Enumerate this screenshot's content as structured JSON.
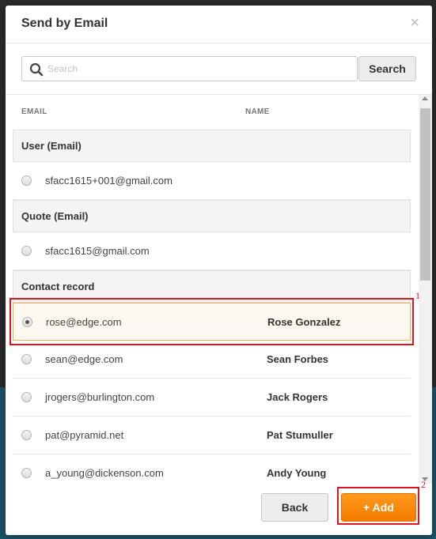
{
  "dialog": {
    "title": "Send by Email",
    "close_glyph": "×"
  },
  "search": {
    "placeholder": "Search",
    "value": "",
    "button_label": "Search"
  },
  "columns": {
    "email": "EMAIL",
    "name": "NAME"
  },
  "groups": [
    {
      "label": "User (Email)",
      "rows": [
        {
          "email": "sfacc1615+001@gmail.com",
          "name": "",
          "selected": false
        }
      ]
    },
    {
      "label": "Quote (Email)",
      "rows": [
        {
          "email": "sfacc1615@gmail.com",
          "name": "",
          "selected": false
        }
      ]
    },
    {
      "label": "Contact record",
      "rows": [
        {
          "email": "rose@edge.com",
          "name": "Rose Gonzalez",
          "selected": true
        },
        {
          "email": "sean@edge.com",
          "name": "Sean Forbes",
          "selected": false
        },
        {
          "email": "jrogers@burlington.com",
          "name": "Jack Rogers",
          "selected": false
        },
        {
          "email": "pat@pyramid.net",
          "name": "Pat Stumuller",
          "selected": false
        },
        {
          "email": "a_young@dickenson.com",
          "name": "Andy Young",
          "selected": false
        }
      ]
    }
  ],
  "footer": {
    "back_label": "Back",
    "add_label": "+ Add"
  },
  "annotations": [
    "1",
    "2"
  ],
  "colors": {
    "accent_orange": "#f47b00",
    "highlight_red": "#e0141e",
    "selected_row_border": "#e9b24a"
  },
  "icons": {
    "search": "search-icon",
    "close": "close-icon"
  }
}
